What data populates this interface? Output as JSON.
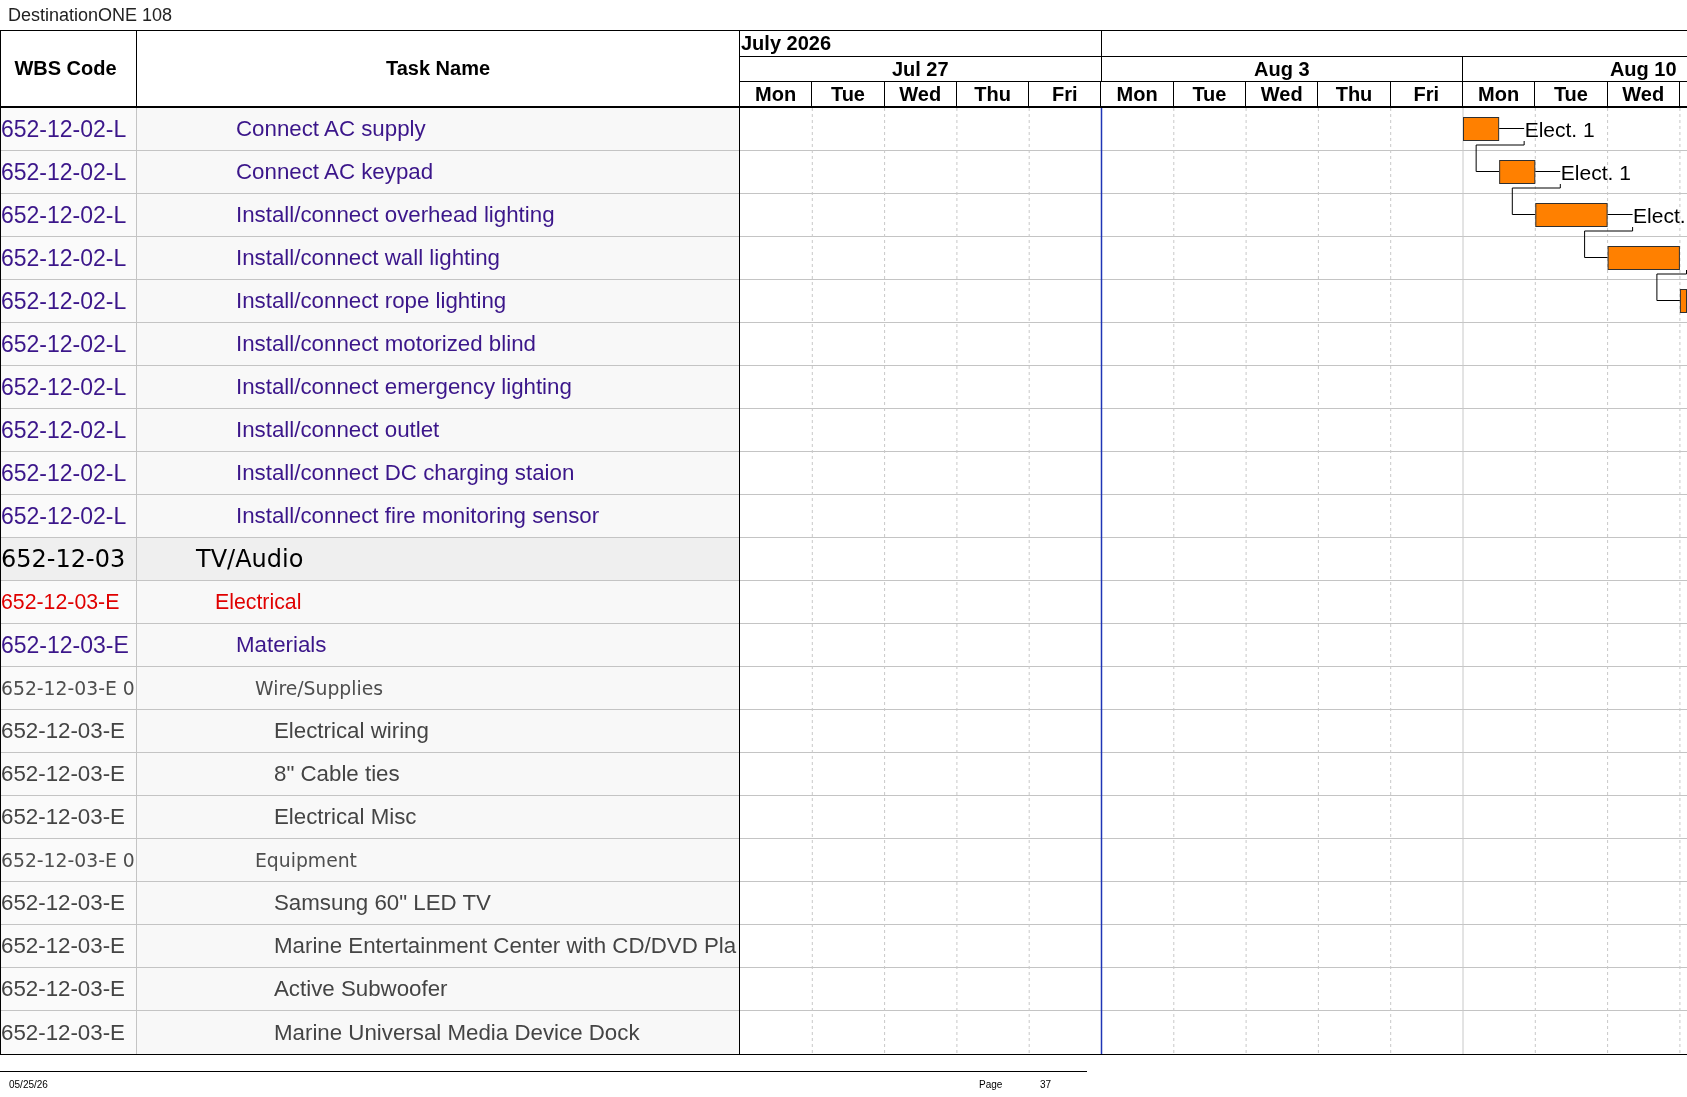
{
  "document": {
    "title": "DestinationONE 108"
  },
  "table": {
    "columns": [
      "WBS Code",
      "Task Name"
    ],
    "rows": [
      {
        "wbs": "652-12-02-L",
        "task": "Connect AC supply",
        "kind": "task",
        "bar": {
          "label": "Elect. 1",
          "linked": false
        }
      },
      {
        "wbs": "652-12-02-L",
        "task": "Connect AC keypad",
        "kind": "task",
        "bar": {
          "label": "Elect. 1",
          "linked": true
        }
      },
      {
        "wbs": "652-12-02-L",
        "task": "Install/connect overhead lighting",
        "kind": "task",
        "bar": {
          "label": "Elect.",
          "linked": true
        }
      },
      {
        "wbs": "652-12-02-L",
        "task": "Install/connect wall lighting",
        "kind": "task",
        "bar": {
          "linked": true
        }
      },
      {
        "wbs": "652-12-02-L",
        "task": "Install/connect rope lighting",
        "kind": "task",
        "bar": {
          "linked": true
        }
      },
      {
        "wbs": "652-12-02-L",
        "task": "Install/connect motorized blind",
        "kind": "task"
      },
      {
        "wbs": "652-12-02-L",
        "task": "Install/connect emergency lighting",
        "kind": "task"
      },
      {
        "wbs": "652-12-02-L",
        "task": "Install/connect outlet",
        "kind": "task"
      },
      {
        "wbs": "652-12-02-L",
        "task": "Install/connect DC charging staion",
        "kind": "task"
      },
      {
        "wbs": "652-12-02-L",
        "task": "Install/connect fire monitoring sensor",
        "kind": "task"
      },
      {
        "wbs": "652-12-03",
        "task": "TV/Audio",
        "kind": "summary",
        "children": [
          {
            "wbs": "652-12-03-E",
            "task": "Electrical",
            "kind": "phase",
            "children": [
              {
                "wbs": "652-12-03-E",
                "task": "Materials",
                "kind": "task",
                "children": [
                  {
                    "wbs": "652-12-03-E 0",
                    "task": "Wire/Supplies",
                    "kind": "group",
                    "children": [
                      {
                        "wbs": "652-12-03-E",
                        "task": "Electrical wiring",
                        "kind": "item"
                      },
                      {
                        "wbs": "652-12-03-E",
                        "task": "8\" Cable ties",
                        "kind": "item"
                      },
                      {
                        "wbs": "652-12-03-E",
                        "task": "Electrical Misc",
                        "kind": "item"
                      }
                    ]
                  },
                  {
                    "wbs": "652-12-03-E 0",
                    "task": "Equipment",
                    "kind": "group",
                    "children": [
                      {
                        "wbs": "652-12-03-E",
                        "task": "Samsung 60\" LED TV",
                        "kind": "item"
                      },
                      {
                        "wbs": "652-12-03-E",
                        "task": "Marine Entertainment Center with CD/DVD Pla",
                        "kind": "item"
                      },
                      {
                        "wbs": "652-12-03-E",
                        "task": "Active Subwoofer",
                        "kind": "item"
                      },
                      {
                        "wbs": "652-12-03-E",
                        "task": "Marine Universal Media Device Dock",
                        "kind": "item"
                      }
                    ]
                  }
                ]
              }
            ]
          }
        ]
      }
    ]
  },
  "timeline": {
    "months": [
      {
        "label": "July 2026",
        "weeks": [
          {
            "label": "Jul 27",
            "status_line": false,
            "days": [
              "Mon",
              "Tue",
              "Wed",
              "Thu",
              "Fri"
            ]
          }
        ]
      },
      {
        "weeks": [
          {
            "label": "Aug 3",
            "status_line": true,
            "days": [
              "Mon",
              "Tue",
              "Wed",
              "Thu",
              "Fri"
            ]
          },
          {
            "label": "Aug 10",
            "status_line": false,
            "days": [
              "Mon",
              "Tue",
              "Wed"
            ]
          }
        ]
      }
    ]
  },
  "footer": {
    "date": "05/25/26",
    "page_label": "Page",
    "page_number": "37"
  }
}
